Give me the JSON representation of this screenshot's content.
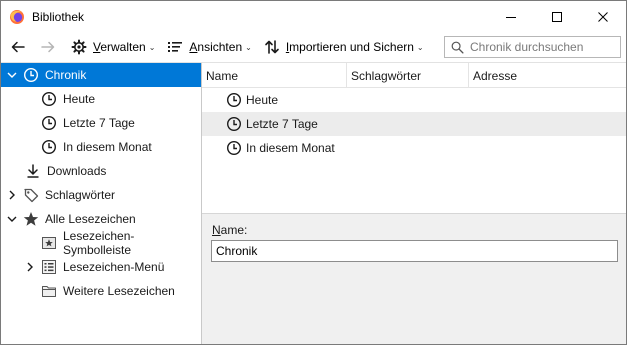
{
  "window": {
    "title": "Bibliothek"
  },
  "toolbar": {
    "organize": {
      "hotkey": "V",
      "rest": "erwalten"
    },
    "views": {
      "hotkey": "A",
      "rest": "nsichten"
    },
    "import": {
      "hotkey": "I",
      "rest": "mportieren und Sichern"
    },
    "search_placeholder": "Chronik durchsuchen"
  },
  "tree": {
    "history": "Chronik",
    "today": "Heute",
    "last7": "Letzte 7 Tage",
    "this_month": "In diesem Monat",
    "downloads": "Downloads",
    "tags": "Schlagwörter",
    "all_bookmarks": "Alle Lesezeichen",
    "bookmarks_toolbar": "Lesezeichen-Symbolleiste",
    "bookmarks_menu": "Lesezeichen-Menü",
    "other_bookmarks": "Weitere Lesezeichen"
  },
  "list": {
    "columns": [
      "Name",
      "Schlagwörter",
      "Adresse"
    ],
    "rows": [
      "Heute",
      "Letzte 7 Tage",
      "In diesem Monat"
    ]
  },
  "details": {
    "name_hotkey": "N",
    "name_rest": "ame:",
    "name_value": "Chronik"
  },
  "colors": {
    "selection": "#0078d7",
    "hover_row": "#ececec",
    "details_bg": "#f0f0f0"
  },
  "icons": {
    "app": "firefox-icon",
    "clock": "clock-icon",
    "downloads": "download-arrow-icon",
    "tags": "tag-icon",
    "star": "star-icon",
    "folder": "folder-icon"
  }
}
